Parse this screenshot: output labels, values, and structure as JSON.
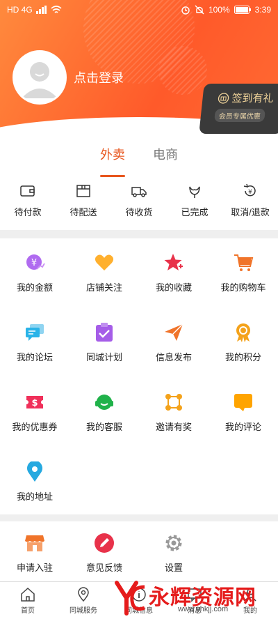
{
  "status_bar": {
    "left": "HD 4G",
    "battery": "100%",
    "time": "3:39"
  },
  "header": {
    "login_text": "点击登录",
    "signin_title": "签到有礼",
    "signin_sub": "会员专属优惠"
  },
  "tabs": [
    {
      "label": "外卖",
      "active": true
    },
    {
      "label": "电商",
      "active": false
    }
  ],
  "orders": [
    {
      "label": "待付款",
      "icon": "wallet-icon"
    },
    {
      "label": "待配送",
      "icon": "box-icon"
    },
    {
      "label": "待收货",
      "icon": "truck-icon"
    },
    {
      "label": "已完成",
      "icon": "flower-icon"
    },
    {
      "label": "取消/退款",
      "icon": "refund-icon"
    }
  ],
  "services": [
    {
      "label": "我的金额",
      "icon": "money-icon",
      "color": "#b06bf0"
    },
    {
      "label": "店铺关注",
      "icon": "heart-icon",
      "color": "#ffb02e"
    },
    {
      "label": "我的收藏",
      "icon": "star-icon",
      "color": "#e8324a"
    },
    {
      "label": "我的购物车",
      "icon": "cart-icon",
      "color": "#f0742a"
    },
    {
      "label": "我的论坛",
      "icon": "chat-icon",
      "color": "#29b3e8"
    },
    {
      "label": "同城计划",
      "icon": "clipboard-icon",
      "color": "#a55de8"
    },
    {
      "label": "信息发布",
      "icon": "paper-plane-icon",
      "color": "#f0742a"
    },
    {
      "label": "我的积分",
      "icon": "medal-icon",
      "color": "#f4a21a"
    },
    {
      "label": "我的优惠券",
      "icon": "coupon-icon",
      "color": "#f0305a"
    },
    {
      "label": "我的客服",
      "icon": "headset-icon",
      "color": "#20b24a"
    },
    {
      "label": "邀请有奖",
      "icon": "share-icon",
      "color": "#f4a21a"
    },
    {
      "label": "我的评论",
      "icon": "comment-icon",
      "color": "#ffa400"
    },
    {
      "label": "我的地址",
      "icon": "location-icon",
      "color": "#26a9e0"
    }
  ],
  "more": [
    {
      "label": "申请入驻",
      "icon": "shop-icon",
      "color": "#f0742a"
    },
    {
      "label": "意见反馈",
      "icon": "pen-icon",
      "color": "#e8324a"
    },
    {
      "label": "设置",
      "icon": "gear-icon",
      "color": "#999999"
    }
  ],
  "tabbar": [
    {
      "label": "首页",
      "icon": "home-icon"
    },
    {
      "label": "同城服务",
      "icon": "map-pin-icon"
    },
    {
      "label": "同城信息",
      "icon": "info-icon"
    },
    {
      "label": "消息",
      "icon": "message-icon"
    },
    {
      "label": "我的",
      "icon": "user-icon"
    }
  ],
  "watermark": {
    "text": "永辉资源网",
    "url": "www.yhkjj.com"
  }
}
